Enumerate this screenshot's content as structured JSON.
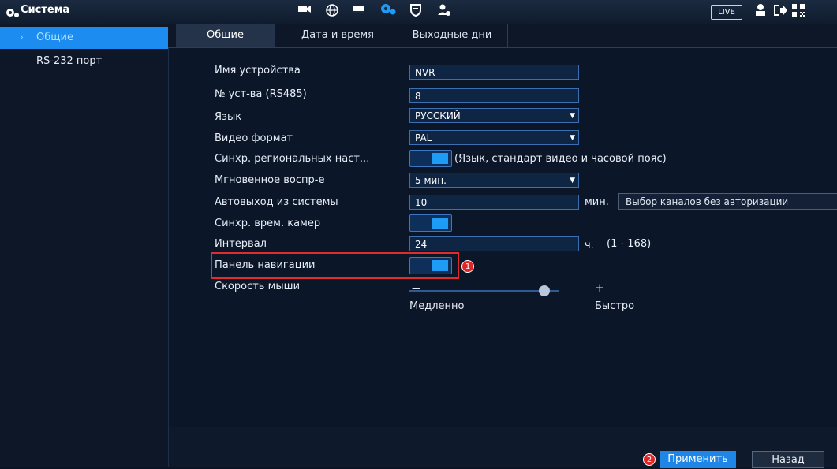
{
  "topbar": {
    "title": "Система",
    "live_label": "LIVE",
    "icons": [
      "gear-icon",
      "camera-icon",
      "network-icon",
      "storage-icon",
      "system-gear-icon",
      "security-shield-icon",
      "account-icon",
      "user-icon",
      "logout-icon",
      "qr-icon"
    ]
  },
  "sidebar": {
    "items": [
      {
        "label": "Общие",
        "active": true
      },
      {
        "label": "RS-232 порт",
        "active": false
      }
    ]
  },
  "tabs": [
    {
      "label": "Общие"
    },
    {
      "label": "Дата и время"
    },
    {
      "label": "Выходные дни"
    }
  ],
  "form": {
    "device_name_label": "Имя устройства",
    "device_name_value": "NVR",
    "device_no_label": "№ уст-ва (RS485)",
    "device_no_value": "8",
    "language_label": "Язык",
    "language_value": "РУССКИЙ",
    "video_format_label": "Видео формат",
    "video_format_value": "PAL",
    "sync_regional_label": "Синхр. региональных наст...",
    "sync_regional_note": "(Язык, стандарт видео и часовой пояс)",
    "instant_playback_label": "Мгновенное воспр-е",
    "instant_playback_value": "5 мин.",
    "auto_logout_label": "Автовыход из системы",
    "auto_logout_value": "10",
    "auto_logout_unit": "мин.",
    "channel_select_label": "Выбор каналов без авторизации",
    "sync_camera_time_label": "Синхр. врем. камер",
    "interval_label": "Интервал",
    "interval_value": "24",
    "interval_unit": "ч.",
    "interval_range": "(1 - 168)",
    "nav_panel_label": "Панель навигации",
    "mouse_speed_label": "Скорость мыши",
    "mouse_slow": "Медленно",
    "mouse_fast": "Быстро",
    "mouse_speed_level": 0.9
  },
  "badges": {
    "one": "1",
    "two": "2"
  },
  "footer": {
    "apply_label": "Применить",
    "back_label": "Назад"
  },
  "colors": {
    "accent": "#1d86e6",
    "highlight": "#e22c2c"
  }
}
